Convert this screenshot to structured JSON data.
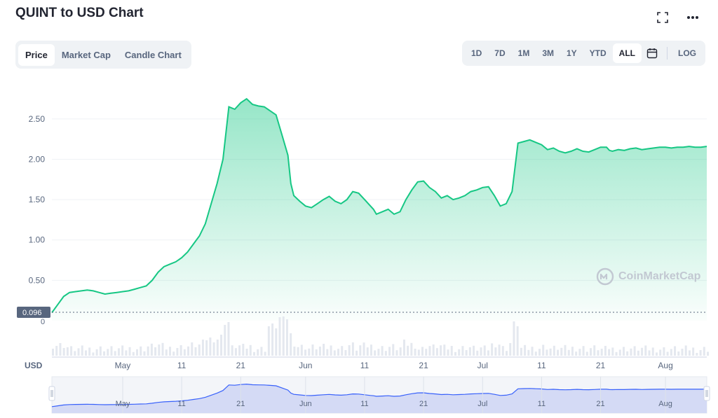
{
  "header": {
    "title": "QUINT to USD Chart",
    "fullscreen_icon": "fullscreen-icon",
    "more_icon": "more-horizontal-icon"
  },
  "tabs": [
    {
      "label": "Price",
      "active": true
    },
    {
      "label": "Market Cap",
      "active": false
    },
    {
      "label": "Candle Chart",
      "active": false
    }
  ],
  "ranges": [
    {
      "label": "1D",
      "active": false
    },
    {
      "label": "7D",
      "active": false
    },
    {
      "label": "1M",
      "active": false
    },
    {
      "label": "3M",
      "active": false
    },
    {
      "label": "1Y",
      "active": false
    },
    {
      "label": "YTD",
      "active": false
    },
    {
      "label": "ALL",
      "active": true
    }
  ],
  "calendar_icon": "calendar-icon",
  "log_label": "LOG",
  "watermark": {
    "text": "CoinMarketCap",
    "icon": "coinmarketcap-logo-icon"
  },
  "colors": {
    "line": "#16c784",
    "fill_top": "#16c784",
    "grid": "#eff2f5",
    "axis_text": "#58667e",
    "navigator_fill": "#d4daf5",
    "navigator_line": "#3861fb",
    "volume": "#e4e8ef",
    "current_label_bg": "#58667e"
  },
  "chart_data": {
    "type": "line",
    "currency_label": "USD",
    "current_value_label": "0.096",
    "volume_zero_label": "0",
    "y_ticks": [
      "0.50",
      "1.00",
      "1.50",
      "2.00",
      "2.50"
    ],
    "ylim": [
      0,
      2.95
    ],
    "x_ticks": [
      {
        "label": "May",
        "day": 12
      },
      {
        "label": "11",
        "day": 22
      },
      {
        "label": "21",
        "day": 32
      },
      {
        "label": "Jun",
        "day": 43
      },
      {
        "label": "11",
        "day": 53
      },
      {
        "label": "21",
        "day": 63
      },
      {
        "label": "Jul",
        "day": 73
      },
      {
        "label": "11",
        "day": 83
      },
      {
        "label": "21",
        "day": 93
      },
      {
        "label": "Aug",
        "day": 104
      }
    ],
    "x_range": [
      0,
      111
    ],
    "series": [
      {
        "x": [
          0,
          1,
          2,
          3,
          4,
          5,
          6,
          7,
          8,
          9,
          10,
          11,
          12,
          13,
          14,
          15,
          16,
          17,
          18,
          19,
          20,
          21,
          22,
          23,
          24,
          25,
          26,
          27,
          28,
          29,
          30,
          31,
          32,
          33,
          34,
          35,
          36,
          37,
          38,
          39,
          40,
          40.5,
          41,
          42,
          43,
          44,
          45,
          46,
          47,
          48,
          49,
          50,
          51,
          52,
          53,
          54,
          54.5,
          55,
          56,
          57,
          58,
          59,
          60,
          61,
          62,
          63,
          64,
          65,
          66,
          67,
          68,
          69,
          70,
          71,
          72,
          73,
          74,
          75,
          76,
          77,
          78,
          79,
          80,
          81,
          82,
          83,
          84,
          85,
          86,
          87,
          88,
          89,
          90,
          91,
          92,
          93,
          94,
          94.5,
          95,
          96,
          97,
          98,
          99,
          100,
          101,
          102,
          103,
          104,
          105,
          106,
          107,
          108,
          109,
          110,
          111
        ],
        "values": [
          0.1,
          0.2,
          0.3,
          0.35,
          0.36,
          0.37,
          0.38,
          0.37,
          0.35,
          0.33,
          0.34,
          0.35,
          0.36,
          0.37,
          0.39,
          0.41,
          0.43,
          0.5,
          0.6,
          0.67,
          0.7,
          0.73,
          0.78,
          0.85,
          0.95,
          1.05,
          1.2,
          1.45,
          1.7,
          2.0,
          2.65,
          2.62,
          2.7,
          2.75,
          2.68,
          2.66,
          2.65,
          2.6,
          2.55,
          2.3,
          2.05,
          1.7,
          1.55,
          1.48,
          1.42,
          1.4,
          1.45,
          1.5,
          1.54,
          1.48,
          1.45,
          1.5,
          1.6,
          1.58,
          1.5,
          1.42,
          1.38,
          1.32,
          1.35,
          1.38,
          1.32,
          1.35,
          1.5,
          1.62,
          1.72,
          1.73,
          1.65,
          1.6,
          1.52,
          1.55,
          1.5,
          1.52,
          1.55,
          1.6,
          1.62,
          1.65,
          1.66,
          1.55,
          1.42,
          1.45,
          1.6,
          2.2,
          2.22,
          2.24,
          2.21,
          2.18,
          2.12,
          2.14,
          2.1,
          2.08,
          2.1,
          2.13,
          2.1,
          2.09,
          2.12,
          2.15,
          2.15,
          2.11,
          2.1,
          2.12,
          2.11,
          2.13,
          2.14,
          2.12,
          2.13,
          2.14,
          2.15,
          2.15,
          2.14,
          2.15,
          2.15,
          2.16,
          2.15,
          2.15,
          2.16
        ]
      }
    ],
    "legend": "none",
    "grid": true
  }
}
